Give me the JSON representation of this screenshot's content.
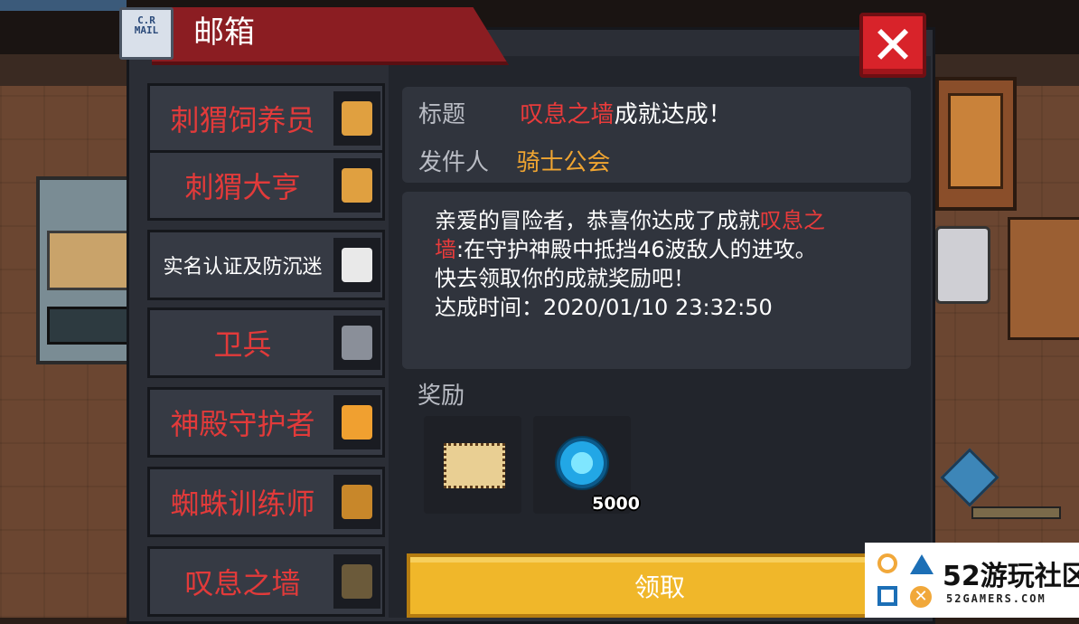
{
  "header": {
    "title": "邮箱",
    "mail_icon_text_line1": "C.R",
    "mail_icon_text_line2": "MAIL",
    "close_label": "✕"
  },
  "mail_list": [
    {
      "label": "刺猬饲养员",
      "style": "red",
      "thumb_color": "#e0a040"
    },
    {
      "label": "刺猬大亨",
      "style": "red",
      "thumb_color": "#e0a040"
    },
    {
      "label": "实名认证及防沉迷",
      "style": "white",
      "thumb_color": "#e9e9e9"
    },
    {
      "label": "卫兵",
      "style": "red",
      "thumb_color": "#8a8f99"
    },
    {
      "label": "神殿守护者",
      "style": "red",
      "thumb_color": "#f0a030"
    },
    {
      "label": "蜘蛛训练师",
      "style": "red",
      "thumb_color": "#c8872a"
    },
    {
      "label": "叹息之墙",
      "style": "red",
      "thumb_color": "#6b5a3a"
    }
  ],
  "detail": {
    "title_label": "标题",
    "title_highlight": "叹息之墙",
    "title_rest": "成就达成！",
    "sender_label": "发件人",
    "sender": "骑士公会",
    "body_line1_prefix": "亲爱的冒险者，恭喜你达成了成就",
    "body_line1_highlight": "叹息之",
    "body_line2_highlight": "墙",
    "body_line2_rest": ":在守护神殿中抵挡46波敌人的进攻。",
    "body_line3": "快去领取你的成就奖励吧！",
    "body_line4": "达成时间：2020/01/10 23:32:50",
    "rewards_label": "奖励",
    "rewards": [
      {
        "icon": "ticket-icon",
        "quantity": ""
      },
      {
        "icon": "gem-icon",
        "quantity": "5000"
      }
    ],
    "claim_label": "领取"
  },
  "watermark": {
    "text": "52游玩社区",
    "sub": "52GAMERS.COM"
  }
}
